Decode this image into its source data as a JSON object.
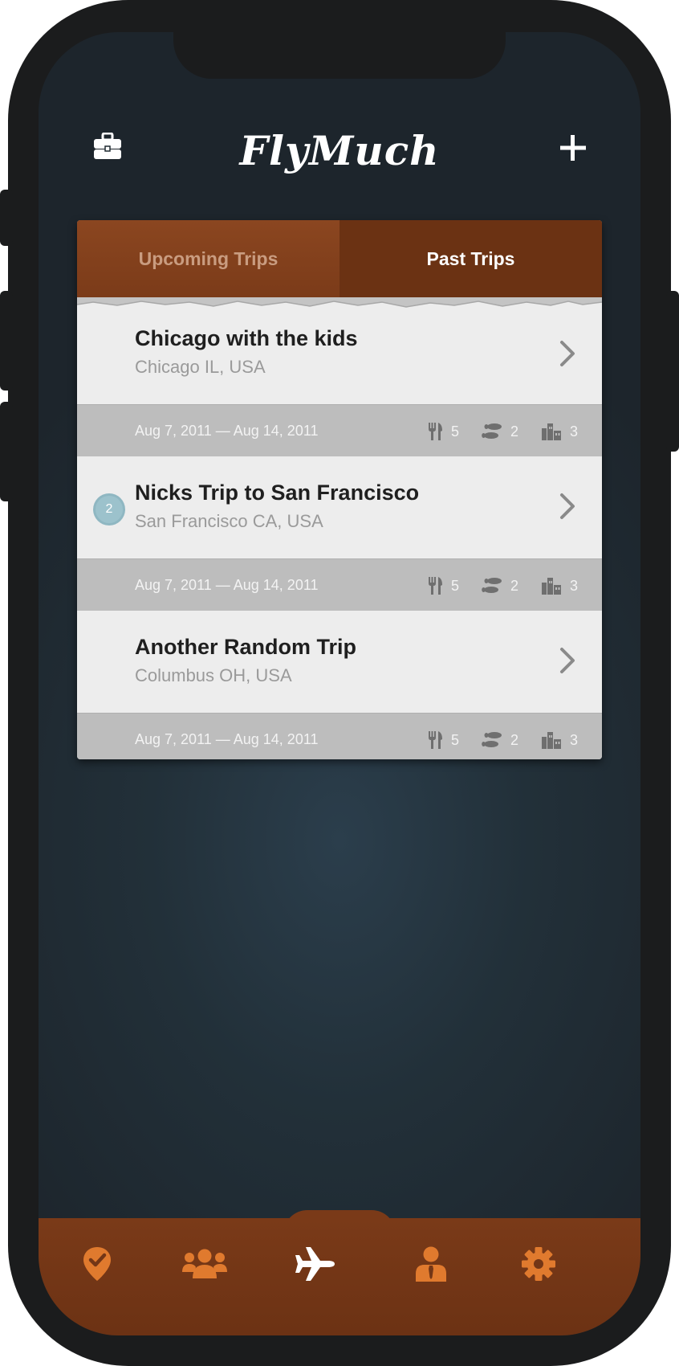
{
  "app": {
    "title": "FlyMuch"
  },
  "header": {
    "left_icon": "briefcase-icon",
    "right_icon": "plus-icon"
  },
  "tabs": [
    {
      "label": "Upcoming Trips",
      "active": false
    },
    {
      "label": "Past Trips",
      "active": true
    }
  ],
  "trips": [
    {
      "name": "Chicago with the kids",
      "location": "Chicago IL, USA",
      "badge": "",
      "dates": "Aug 7, 2011 — Aug 14, 2011",
      "restaurants": "5",
      "activities": "2",
      "sights": "3"
    },
    {
      "name": "Nicks Trip to San Francisco",
      "location": "San Francisco CA, USA",
      "badge": "2",
      "dates": "Aug 7, 2011 — Aug 14, 2011",
      "restaurants": "5",
      "activities": "2",
      "sights": "3"
    },
    {
      "name": "Another Random Trip",
      "location": "Columbus OH, USA",
      "badge": "",
      "dates": "Aug 7, 2011 — Aug 14, 2011",
      "restaurants": "5",
      "activities": "2",
      "sights": "3"
    }
  ],
  "bottom_nav": [
    {
      "icon": "location-check-icon",
      "active": false
    },
    {
      "icon": "users-icon",
      "active": false
    },
    {
      "icon": "airplane-icon",
      "active": true
    },
    {
      "icon": "person-icon",
      "active": false
    },
    {
      "icon": "gear-icon",
      "active": false
    }
  ],
  "colors": {
    "accent": "#e07a2e",
    "tab_brown": "#7a3a18",
    "badge": "#8fb7c2"
  }
}
